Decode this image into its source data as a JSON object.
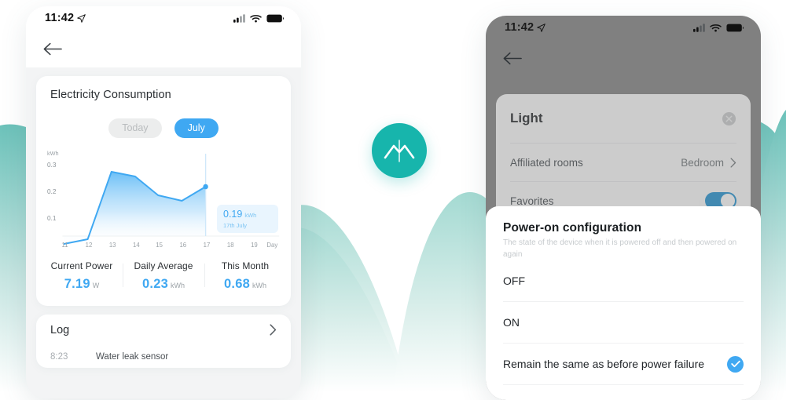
{
  "brand": {
    "logo_icon": "mountain-logo-icon",
    "logo_color": "#17b5ac",
    "accent_blue": "#3fa8f2",
    "accent_teal": "#8fd2cb"
  },
  "left_phone": {
    "status": {
      "time": "11:42",
      "location_icon": "location-arrow-icon",
      "cellular_icon": "cellular-signal-icon",
      "wifi_icon": "wifi-icon",
      "battery_icon": "battery-full-icon"
    },
    "nav": {
      "back_icon": "back-arrow-icon"
    },
    "energy_card": {
      "title": "Electricity Consumption",
      "pills": [
        {
          "label": "Today",
          "active": false
        },
        {
          "label": "July",
          "active": true
        }
      ],
      "tooltip": {
        "value": "0.19",
        "unit": "kWh",
        "date": "17th July"
      },
      "stats": [
        {
          "label": "Current Power",
          "value": "7.19",
          "unit": "W"
        },
        {
          "label": "Daily Average",
          "value": "0.23",
          "unit": "kWh"
        },
        {
          "label": "This Month",
          "value": "0.68",
          "unit": "kWh"
        }
      ]
    },
    "log_card": {
      "title": "Log",
      "chevron_icon": "chevron-right-icon",
      "rows": [
        {
          "time": "8:23",
          "text": "Water leak sensor"
        }
      ]
    }
  },
  "right_phone": {
    "status": {
      "time": "11:42",
      "location_icon": "location-arrow-icon",
      "cellular_icon": "cellular-signal-icon",
      "wifi_icon": "wifi-icon",
      "battery_icon": "battery-full-icon"
    },
    "nav": {
      "back_icon": "back-arrow-icon"
    },
    "device_card": {
      "title": "Light",
      "close_icon": "close-circle-icon",
      "rows": [
        {
          "label": "Affiliated rooms",
          "value": "Bedroom",
          "chevron_icon": "chevron-right-icon"
        },
        {
          "label": "Favorites",
          "toggle": "on"
        }
      ]
    },
    "sheet": {
      "title": "Power-on configuration",
      "subtitle": "The state of the device when it is powered off and then powered on again",
      "options": [
        {
          "label": "OFF",
          "selected": false
        },
        {
          "label": "ON",
          "selected": false
        },
        {
          "label": "Remain the same as before power failure",
          "selected": true
        }
      ],
      "check_icon": "check-circle-icon"
    }
  },
  "chart_data": {
    "type": "area",
    "title": "Electricity Consumption",
    "xlabel": "Day",
    "ylabel": "kWh",
    "x": [
      11,
      12,
      13,
      14,
      15,
      16,
      17,
      18,
      19
    ],
    "xtick_labels": [
      "11",
      "12",
      "13",
      "14",
      "15",
      "16",
      "17",
      "18",
      "19"
    ],
    "ytick_labels": [
      "0.1",
      "0.2",
      "0.3"
    ],
    "yticks": [
      0.1,
      0.2,
      0.3
    ],
    "ylim": [
      0,
      0.33
    ],
    "xlim": [
      11,
      19.6
    ],
    "series": [
      {
        "name": "Consumption",
        "values": [
          0.012,
          0.035,
          0.245,
          0.225,
          0.155,
          0.135,
          0.19,
          null,
          null
        ]
      }
    ],
    "highlight": {
      "x": 17,
      "y": 0.19,
      "label": "0.19",
      "unit": "kWh",
      "date": "17th July"
    },
    "grid": false,
    "legend": "none",
    "line_color": "#3fa8f2",
    "fill_gradient": [
      "#6fc0f6",
      "#ffffff"
    ]
  }
}
